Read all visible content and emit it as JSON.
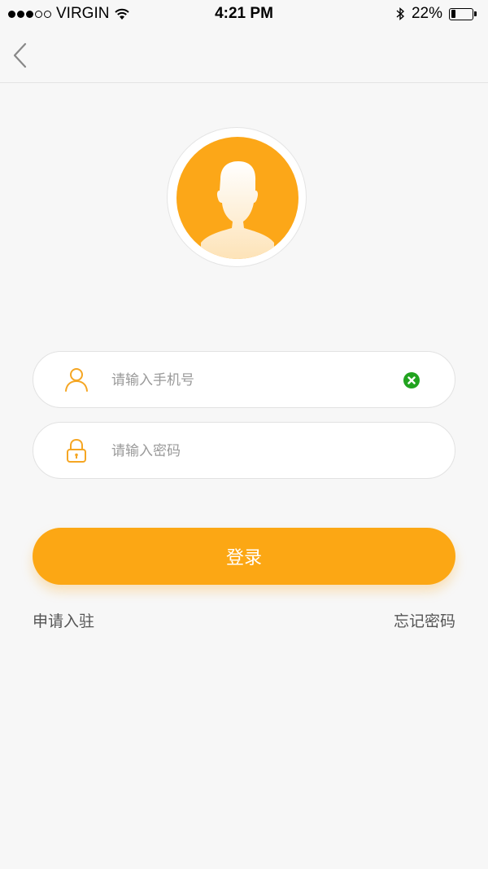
{
  "status_bar": {
    "carrier": "VIRGIN",
    "time": "4:21 PM",
    "battery": "22%",
    "battery_level": 0.22,
    "signal_bars_filled": 3,
    "signal_bars_total": 5
  },
  "nav": {
    "back_icon": "chevron-left-icon"
  },
  "avatar": {
    "icon": "user-silhouette-icon",
    "color": "#fca718"
  },
  "form": {
    "phone": {
      "icon": "user-icon",
      "placeholder": "请输入手机号",
      "value": "",
      "clear_icon": "clear-circle-icon"
    },
    "password": {
      "icon": "lock-icon",
      "placeholder": "请输入密码",
      "value": ""
    },
    "login_label": "登录"
  },
  "links": {
    "apply": "申请入驻",
    "forgot": "忘记密码"
  },
  "colors": {
    "accent": "#fca714",
    "clear": "#21a31f",
    "background": "#f7f7f7"
  }
}
